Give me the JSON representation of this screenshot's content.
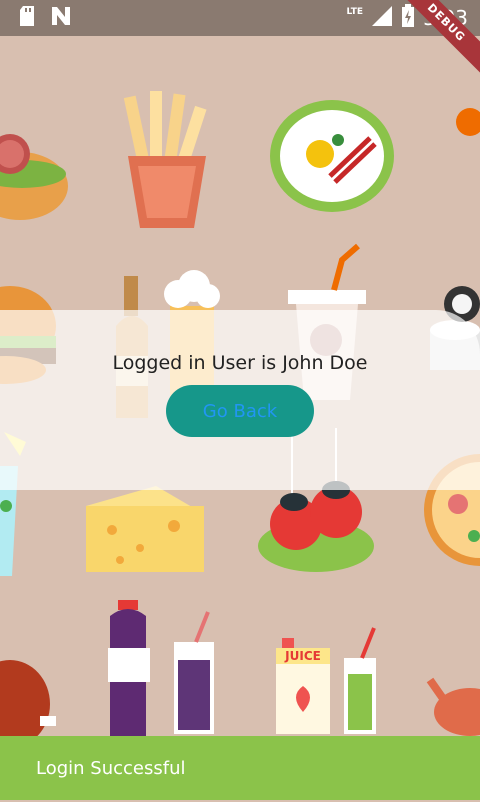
{
  "status_bar": {
    "time": "3:03",
    "network": "LTE",
    "left_icons": [
      "sd-card-icon",
      "notification-n-icon"
    ],
    "right_icons": [
      "signal-icon",
      "battery-charging-icon"
    ]
  },
  "debug_banner": "DEBUG",
  "main": {
    "message": "Logged in User is John Doe",
    "back_button_label": "Go Back"
  },
  "snackbar": {
    "text": "Login Successful"
  },
  "colors": {
    "background": "#d8bfb0",
    "button": "#16978a",
    "button_text": "#2196f3",
    "snackbar": "#8bc34a",
    "debug_ribbon": "#a8353a"
  }
}
